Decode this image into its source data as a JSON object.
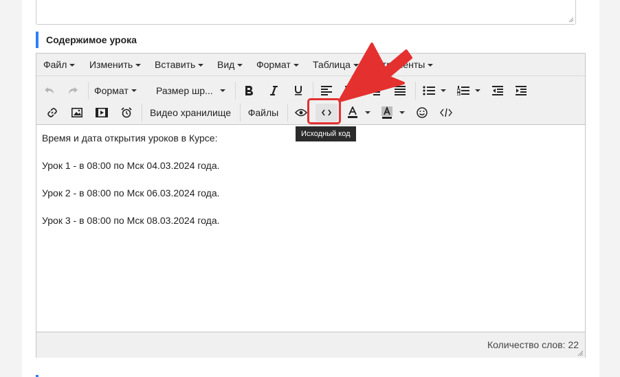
{
  "section": {
    "title": "Содержимое урока"
  },
  "menubar": {
    "items": [
      "Файл",
      "Изменить",
      "Вставить",
      "Вид",
      "Формат",
      "Таблица",
      "Инструменты"
    ]
  },
  "toolbar": {
    "format_label": "Формат",
    "font_size_label": "Размер шр...",
    "video_storage_label": "Видео хранилище",
    "files_label": "Файлы",
    "icons": [
      "undo-icon",
      "redo-icon",
      "bold-icon",
      "italic-icon",
      "underline-icon",
      "align-left-icon",
      "align-center-icon",
      "align-right-icon",
      "align-justify-icon",
      "bullet-list-icon",
      "numbered-list-icon",
      "outdent-icon",
      "indent-icon",
      "link-icon",
      "image-icon",
      "media-icon",
      "alarm-icon",
      "preview-icon",
      "source-code-icon",
      "text-color-icon",
      "background-color-icon",
      "emoticons-icon",
      "code-sample-icon"
    ]
  },
  "tooltip": {
    "text": "Исходный код"
  },
  "content": {
    "lines": [
      "Время и дата открытия уроков в Курсе:",
      "Урок 1 - в 08:00 по Мск 04.03.2024 года.",
      "Урок 2 - в 08:00 по Мск 06.03.2024 года.",
      "Урок 3 - в 08:00 по Мск 08.03.2024 года."
    ]
  },
  "statusbar": {
    "word_count": "Количество слов: 22"
  },
  "colors": {
    "accent": "#2d7ff9",
    "annotation": "#e53030"
  }
}
